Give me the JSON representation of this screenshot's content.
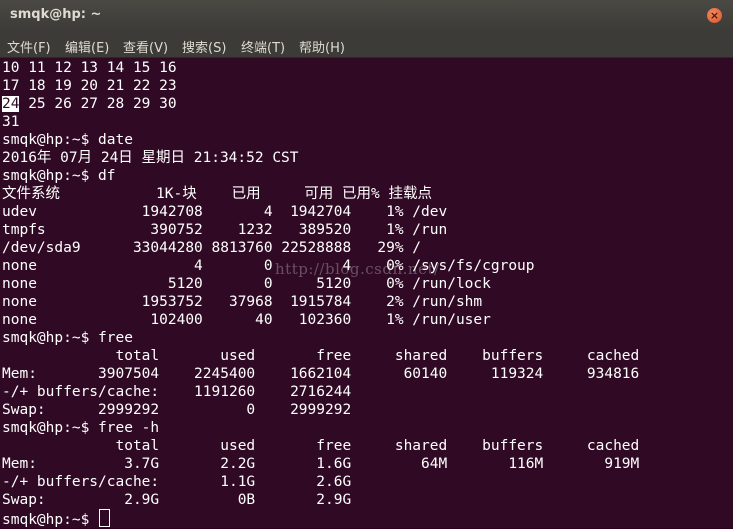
{
  "window": {
    "title": "smqk@hp: ~",
    "close_glyph": "×"
  },
  "menu": [
    "文件(F)",
    "编辑(E)",
    "查看(V)",
    "搜索(S)",
    "终端(T)",
    "帮助(H)"
  ],
  "terminal": {
    "lines": [
      "10 11 12 13 14 15 16",
      "17 18 19 20 21 22 23",
      " 25 26 27 28 29 30",
      "31",
      "smqk@hp:~$ date",
      "2016年 07月 24日 星期日 21:34:52 CST",
      "smqk@hp:~$ df",
      "文件系统           1K-块    已用     可用 已用% 挂载点",
      "udev            1942708       4  1942704    1% /dev",
      "tmpfs            390752    1232   389520    1% /run",
      "/dev/sda9      33044280 8813760 22528888   29% /",
      "none                  4       0        4    0% /sys/fs/cgroup",
      "none               5120       0     5120    0% /run/lock",
      "none            1953752   37968  1915784    2% /run/shm",
      "none             102400      40   102360    1% /run/user",
      "smqk@hp:~$ free",
      "             total       used       free     shared    buffers     cached",
      "Mem:       3907504    2245400    1662104      60140     119324     934816",
      "-/+ buffers/cache:    1191260    2716244",
      "Swap:      2999292          0    2999292",
      "smqk@hp:~$ free -h",
      "             total       used       free     shared    buffers     cached",
      "Mem:          3.7G       2.2G       1.6G        64M       116M       919M",
      "-/+ buffers/cache:       1.1G       2.6G",
      "Swap:         2.9G         0B       2.9G"
    ],
    "highlighted_day": "24",
    "prompt": "smqk@hp:~$ ",
    "watermark": "http://blog.csdn.net/"
  }
}
